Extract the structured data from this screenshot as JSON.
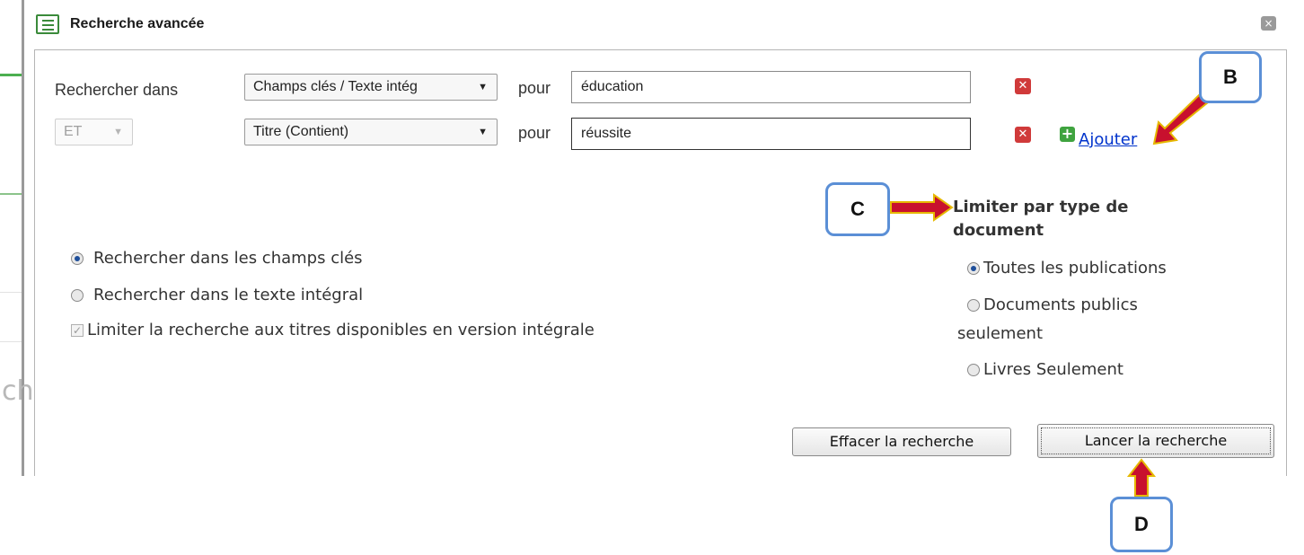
{
  "dialog": {
    "title": "Recherche avancée",
    "close_symbol": "×"
  },
  "rows": [
    {
      "prefix_label": "Rechercher dans",
      "field": "Champs clés / Texte intég",
      "pour_label": "pour",
      "value": "éducation"
    },
    {
      "operator": "ET",
      "field": "Titre (Contient)",
      "pour_label": "pour",
      "value": "réussite"
    }
  ],
  "add_link": "Ajouter",
  "search_scope": {
    "options": [
      "Rechercher dans les champs clés",
      "Rechercher dans le texte intégral"
    ],
    "selected": 0
  },
  "fulltext_limit": {
    "label": "Limiter la recherche aux titres disponibles en version intégrale",
    "checked": true,
    "disabled": true
  },
  "doc_type": {
    "heading_line1": "Limiter par type de",
    "heading_line2": "document",
    "options": [
      {
        "line1": "Toutes les publications",
        "line2": ""
      },
      {
        "line1": "Documents publics",
        "line2": "seulement"
      },
      {
        "line1": "Livres Seulement",
        "line2": ""
      }
    ],
    "selected": 0
  },
  "buttons": {
    "clear": "Effacer la recherche",
    "search": "Lancer la recherche"
  },
  "callouts": [
    "B",
    "C",
    "D"
  ],
  "background_fragment": "ch",
  "colors": {
    "accent_blue": "#5b8fd6",
    "arrow_red": "#c8102e",
    "arrow_outline": "#e6b800",
    "remove_red": "#d03a3a",
    "add_green": "#3fa33f",
    "link_blue": "#0033cc"
  },
  "icons": {
    "title": "form-icon",
    "close": "close-icon",
    "remove": "remove-icon",
    "add": "add-icon",
    "dropdown": "chevron-down-icon"
  }
}
